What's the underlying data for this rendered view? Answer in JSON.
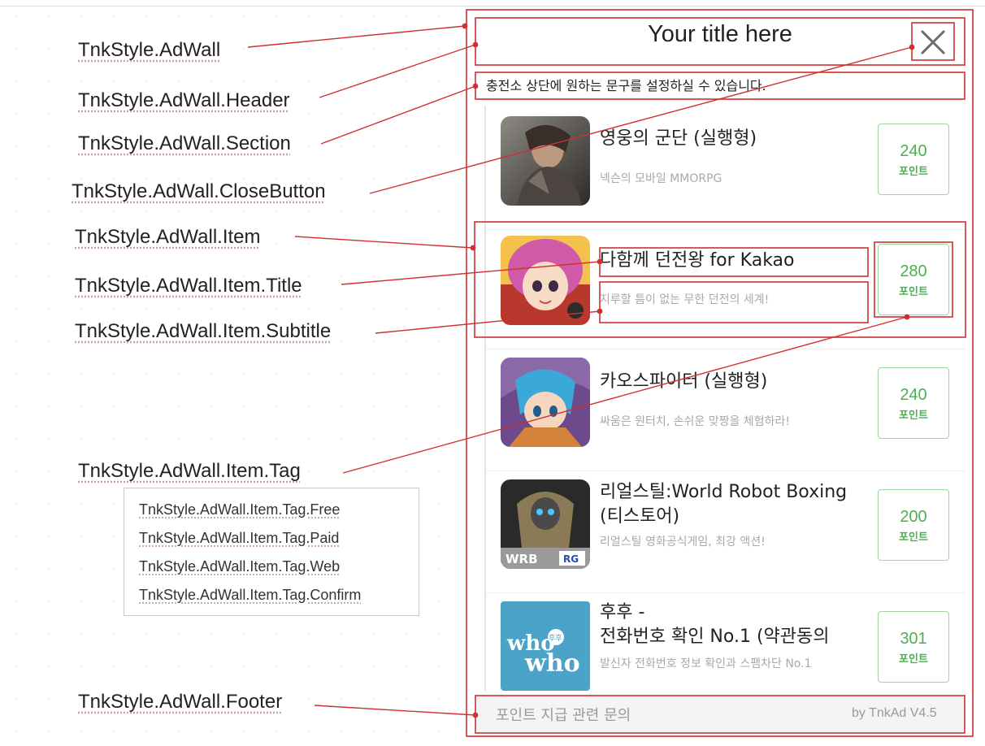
{
  "labels": {
    "adwall": "TnkStyle.AdWall",
    "header": "TnkStyle.AdWall.Header",
    "section": "TnkStyle.AdWall.Section",
    "close_button": "TnkStyle.AdWall.CloseButton",
    "item": "TnkStyle.AdWall.Item",
    "item_title": "TnkStyle.AdWall.Item.Title",
    "item_subtitle": "TnkStyle.AdWall.Item.Subtitle",
    "item_tag": "TnkStyle.AdWall.Item.Tag",
    "footer": "TnkStyle.AdWall.Footer"
  },
  "tag_variants": [
    "TnkStyle.AdWall.Item.Tag.Free",
    "TnkStyle.AdWall.Item.Tag.Paid",
    "TnkStyle.AdWall.Item.Tag.Web",
    "TnkStyle.AdWall.Item.Tag.Confirm"
  ],
  "header": {
    "title": "Your title here",
    "close_icon": "close-x-icon"
  },
  "section": {
    "text": "충전소 상단에 원하는 문구를 설정하실 수 있습니다."
  },
  "items": [
    {
      "title": "영웅의 군단 (실행형)",
      "title2": "",
      "subtitle": "넥슨의 모바일 MMORPG",
      "points": "240",
      "unit": "포인트",
      "icon": "warrior-game-icon"
    },
    {
      "title": "다함께 던전왕 for Kakao",
      "title2": "",
      "subtitle": "지루할 틈이 없는 무한 던전의 세계!",
      "points": "280",
      "unit": "포인트",
      "icon": "pink-hair-girl-icon"
    },
    {
      "title": "카오스파이터 (실행형)",
      "title2": "",
      "subtitle": "싸움은 원터치, 손쉬운 맞짱을 체험하라!",
      "points": "240",
      "unit": "포인트",
      "icon": "blue-hair-fighter-icon"
    },
    {
      "title": "리얼스틸:World Robot Boxing",
      "title2": " (티스토어)",
      "subtitle": "리얼스틸 영화공식게임, 최강 액션!",
      "points": "200",
      "unit": "포인트",
      "icon": "robot-boxer-icon",
      "badge1": "WRB",
      "badge2": "RG"
    },
    {
      "title": "후후 -",
      "title2": " 전화번호 확인 No.1 (약관동의",
      "subtitle": "발신자 전화번호 정보 확인과 스팸차단 No.1",
      "points": "301",
      "unit": "포인트",
      "icon": "whowho-logo-icon",
      "logo1": "who",
      "logo2": "who",
      "logo_mark": "후후"
    }
  ],
  "footer": {
    "left": "포인트 지급 관련 문의",
    "right": "by TnkAd V4.5"
  },
  "colors": {
    "annotation": "#d0302f",
    "tag_green": "#4caf50",
    "tag_border": "#9fd79f"
  }
}
